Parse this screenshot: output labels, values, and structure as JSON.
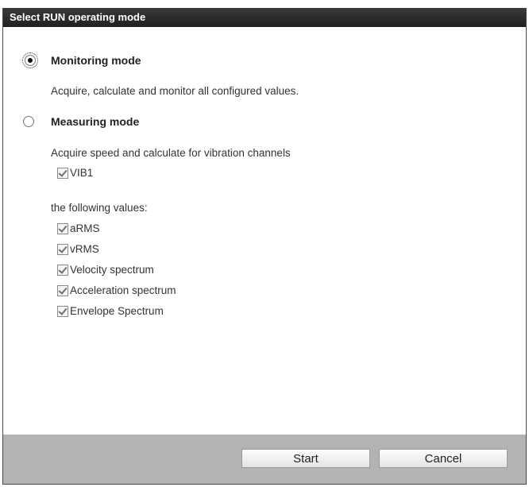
{
  "dialog": {
    "title": "Select RUN operating mode"
  },
  "monitoring": {
    "label": "Monitoring mode",
    "selected": true,
    "description": "Acquire, calculate and monitor all configured values."
  },
  "measuring": {
    "label": "Measuring mode",
    "selected": false,
    "description": "Acquire speed and calculate for vibration channels",
    "channels": [
      {
        "label": "VIB1",
        "checked": true
      }
    ],
    "values_label": "the following values:",
    "values": [
      {
        "label": "aRMS",
        "checked": true
      },
      {
        "label": "vRMS",
        "checked": true
      },
      {
        "label": "Velocity spectrum",
        "checked": true
      },
      {
        "label": "Acceleration spectrum",
        "checked": true
      },
      {
        "label": "Envelope Spectrum",
        "checked": true
      }
    ]
  },
  "buttons": {
    "start_label": "Start",
    "cancel_label": "Cancel"
  },
  "colors": {
    "titlebar": "#2a2a2a",
    "footer": "#b3b3b3"
  }
}
